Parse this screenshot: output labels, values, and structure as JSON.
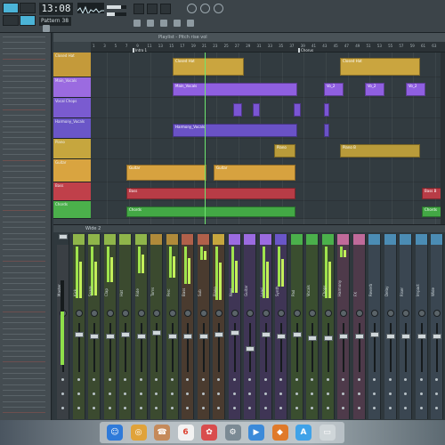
{
  "toolbar": {
    "time": "13:08",
    "time_sub": "0",
    "pattern_label": "Pattern 38"
  },
  "playlist": {
    "title": "Playlist - Pitch rise vol",
    "markers": [
      "Intro 1",
      "Chorus"
    ],
    "ticks": [
      "1",
      "3",
      "5",
      "7",
      "9",
      "11",
      "13",
      "15",
      "17",
      "19",
      "21",
      "23",
      "25",
      "27",
      "29",
      "31",
      "33",
      "35",
      "37",
      "39",
      "41",
      "43",
      "45",
      "47",
      "49",
      "51",
      "53",
      "55",
      "57",
      "59",
      "61",
      "63"
    ],
    "tracks": [
      {
        "name": "Closed Hat",
        "color": "#c49a3a"
      },
      {
        "name": "Main_Vocals",
        "color": "#9b6be0"
      },
      {
        "name": "Vocal Chops",
        "color": "#7a5bd0"
      },
      {
        "name": "Harmony_Vocals",
        "color": "#6a56c8"
      },
      {
        "name": "Piano",
        "color": "#c6a63e"
      },
      {
        "name": "Guitar",
        "color": "#d9a440"
      },
      {
        "name": "Bass",
        "color": "#c0404a"
      },
      {
        "name": "Chords",
        "color": "#4bb04b"
      }
    ],
    "clips": {
      "hat": "Closed Hat",
      "vocals": "Main_Vocals",
      "voc": "Vo_2",
      "harmony": "Harmony_Vocals",
      "piano": "Piano",
      "piano_b": "Piano B",
      "guitar": "Guitar",
      "bass": "Bass",
      "bass_b": "Bass B",
      "chords": "Chords"
    }
  },
  "mixer": {
    "title": "Wide 2",
    "strips": [
      "Master",
      "Kick",
      "Snare",
      "Clap",
      "Hat",
      "Ride",
      "Toms",
      "Perc",
      "Bass",
      "Sub",
      "Piano",
      "Keys",
      "Guitar",
      "Lead",
      "Synth",
      "Pad",
      "Vocals",
      "Chops",
      "Harmony",
      "FX",
      "Reverb",
      "Delay",
      "Riser",
      "Impact",
      "Wide"
    ]
  },
  "dock": {
    "apps": [
      "finder-icon",
      "chrome-icon",
      "contacts-icon",
      "calendar-icon",
      "photos-icon",
      "system-prefs-icon",
      "quicktime-icon",
      "fl-studio-icon",
      "app-store-icon",
      "trash-icon"
    ]
  },
  "colors": {
    "accent": "#4bb4d8",
    "meter": "#9fe34d",
    "playhead": "#6ee66e"
  }
}
